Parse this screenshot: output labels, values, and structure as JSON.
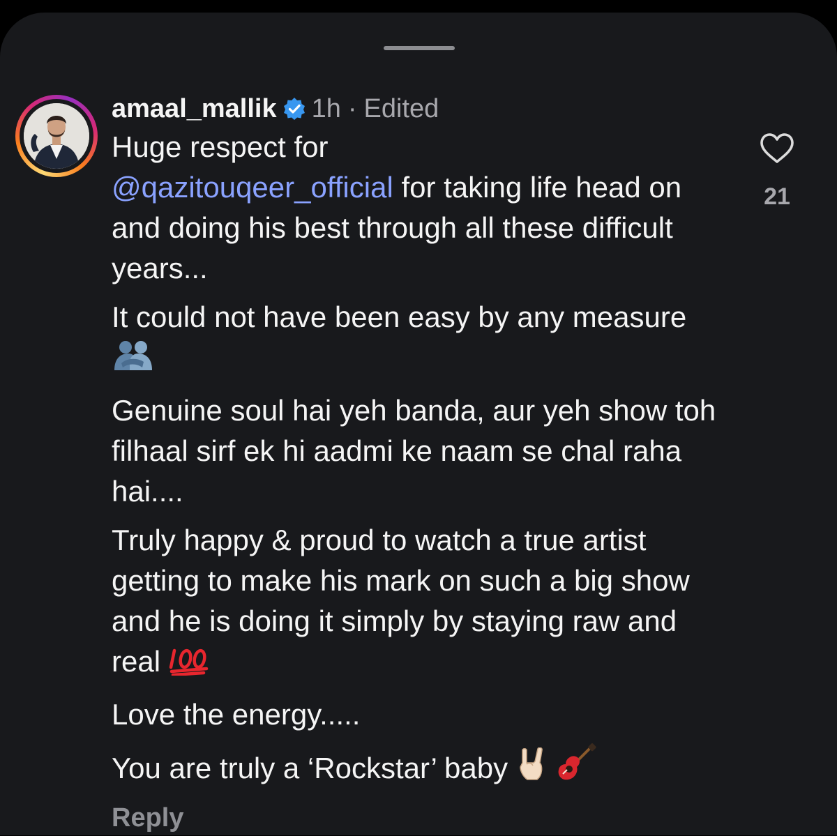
{
  "comment": {
    "username": "amaal_mallik",
    "time": "1h",
    "separator": "·",
    "edited": "Edited",
    "paragraphs": {
      "p1_line1": "Huge respect for",
      "p1_mention": "@qazitouqeer_official",
      "p1_rest": "for taking life head on and doing his best through all these difficult years...",
      "p2": "It could not have been easy by any measure",
      "p3": "Genuine soul hai yeh banda, aur yeh show toh filhaal sirf ek hi aadmi ke naam se chal raha hai....",
      "p4": "Truly happy & proud to watch a true artist getting to make his mark on such a big show and he is doing it simply by staying raw and real",
      "p5": "Love the energy.....",
      "p6": "You are truly a ‘Rockstar’ baby"
    },
    "reply_label": "Reply",
    "like_count": "21"
  },
  "icons": {
    "verified": "verified-badge-icon",
    "heart": "heart-outline-icon",
    "hug": "people-hugging-emoji",
    "hundred": "hundred-points-emoji",
    "horns": "sign-of-the-horns-emoji",
    "guitar": "guitar-emoji"
  },
  "colors": {
    "background": "#18191c",
    "mention": "#8aa2ff",
    "verified": "#3897f0",
    "muted": "#a8a8ad"
  }
}
